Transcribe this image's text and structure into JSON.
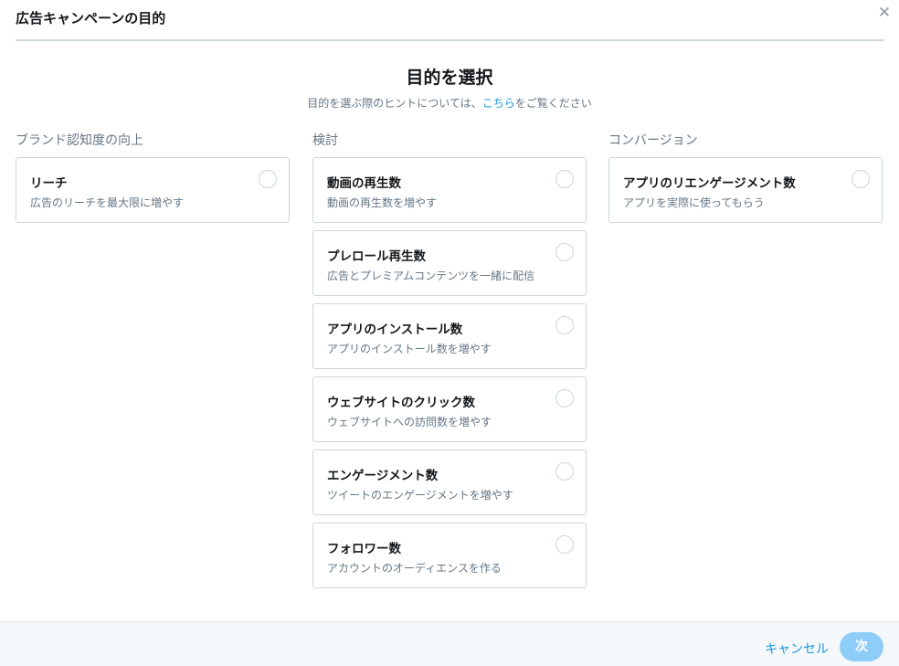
{
  "header": {
    "title": "広告キャンペーンの目的",
    "close_icon": "close-icon"
  },
  "heading": "目的を選択",
  "hint": {
    "before": "目的を選ぶ際のヒントについては、",
    "link": "こちら",
    "after": "をご覧ください"
  },
  "columns": [
    {
      "title": "ブランド認知度の向上",
      "cards": [
        {
          "title": "リーチ",
          "desc": "広告のリーチを最大限に増やす"
        }
      ]
    },
    {
      "title": "検討",
      "cards": [
        {
          "title": "動画の再生数",
          "desc": "動画の再生数を増やす"
        },
        {
          "title": "プレロール再生数",
          "desc": "広告とプレミアムコンテンツを一緒に配信"
        },
        {
          "title": "アプリのインストール数",
          "desc": "アプリのインストール数を増やす"
        },
        {
          "title": "ウェブサイトのクリック数",
          "desc": "ウェブサイトへの訪問数を増やす"
        },
        {
          "title": "エンゲージメント数",
          "desc": "ツイートのエンゲージメントを増やす"
        },
        {
          "title": "フォロワー数",
          "desc": "アカウントのオーディエンスを作る"
        }
      ]
    },
    {
      "title": "コンバージョン",
      "cards": [
        {
          "title": "アプリのリエンゲージメント数",
          "desc": "アプリを実際に使ってもらう"
        }
      ]
    }
  ],
  "footer": {
    "cancel_label": "キャンセル",
    "next_label": "次"
  },
  "colors": {
    "accent": "#1b95e0",
    "next_disabled": "#8ecdf7",
    "border": "#ccd6dd"
  }
}
